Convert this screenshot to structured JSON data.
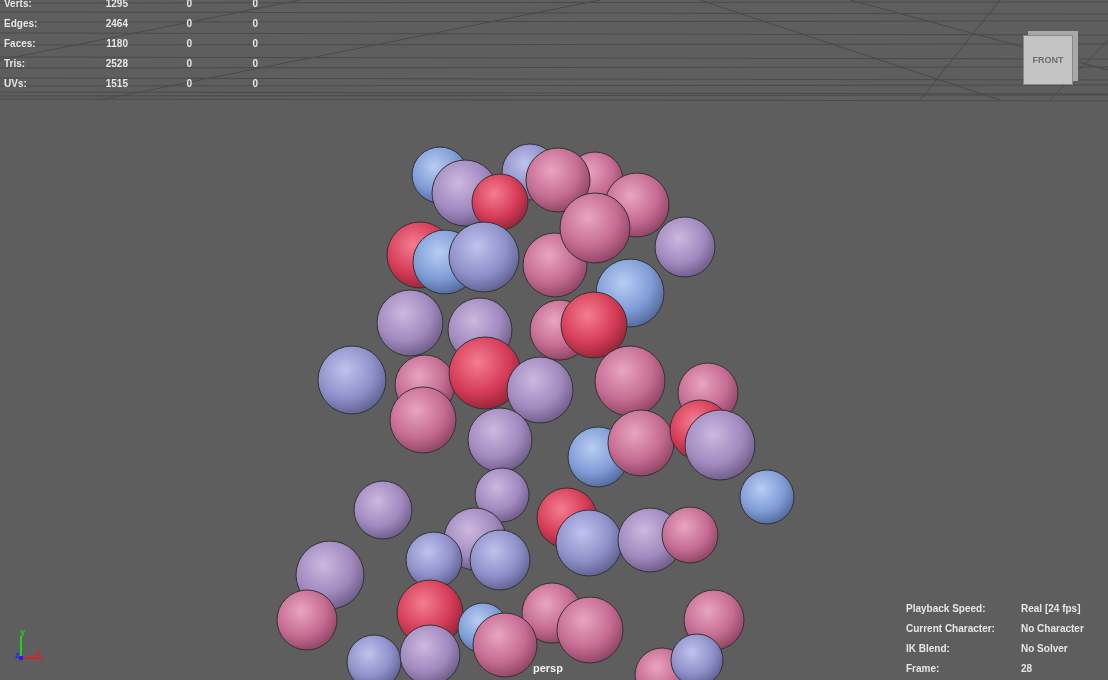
{
  "poly_stats": [
    {
      "label": "Verts:",
      "values": [
        "1295",
        "0",
        "0"
      ]
    },
    {
      "label": "Edges:",
      "values": [
        "2464",
        "0",
        "0"
      ]
    },
    {
      "label": "Faces:",
      "values": [
        "1180",
        "0",
        "0"
      ]
    },
    {
      "label": "Tris:",
      "values": [
        "2528",
        "0",
        "0"
      ]
    },
    {
      "label": "UVs:",
      "values": [
        "1515",
        "0",
        "0"
      ]
    }
  ],
  "view_cube": {
    "label": "FRONT"
  },
  "axes": {
    "y": "y",
    "z": "z",
    "x": "x"
  },
  "camera_label": "persp",
  "hud": [
    {
      "label": "Playback Speed:",
      "value": "Real [24 fps]"
    },
    {
      "label": "Current Character:",
      "value": "No Character"
    },
    {
      "label": "IK Blend:",
      "value": "No Solver"
    },
    {
      "label": "Frame:",
      "value": "28"
    }
  ]
}
